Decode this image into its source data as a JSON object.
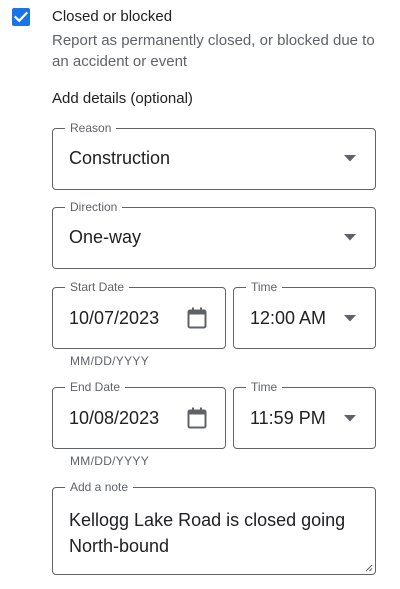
{
  "option": {
    "checked": true,
    "title": "Closed or blocked",
    "description": "Report as permanently closed, or blocked due to an accident or event"
  },
  "details": {
    "title": "Add details (optional)"
  },
  "reason": {
    "label": "Reason",
    "value": "Construction"
  },
  "direction": {
    "label": "Direction",
    "value": "One-way"
  },
  "start": {
    "date_label": "Start Date",
    "date_value": "10/07/2023",
    "date_helper": "MM/DD/YYYY",
    "time_label": "Time",
    "time_value": "12:00 AM"
  },
  "end": {
    "date_label": "End Date",
    "date_value": "10/08/2023",
    "date_helper": "MM/DD/YYYY",
    "time_label": "Time",
    "time_value": "11:59 PM"
  },
  "note": {
    "label": "Add a note",
    "value": "Kellogg Lake Road is closed going North-bound"
  },
  "icons": {
    "checkbox": "checkbox-checked-icon",
    "dropdown": "caret-down-icon",
    "calendar": "calendar-icon"
  },
  "colors": {
    "accent": "#1a73e8",
    "outline": "#5f6368",
    "text": "#202124"
  }
}
